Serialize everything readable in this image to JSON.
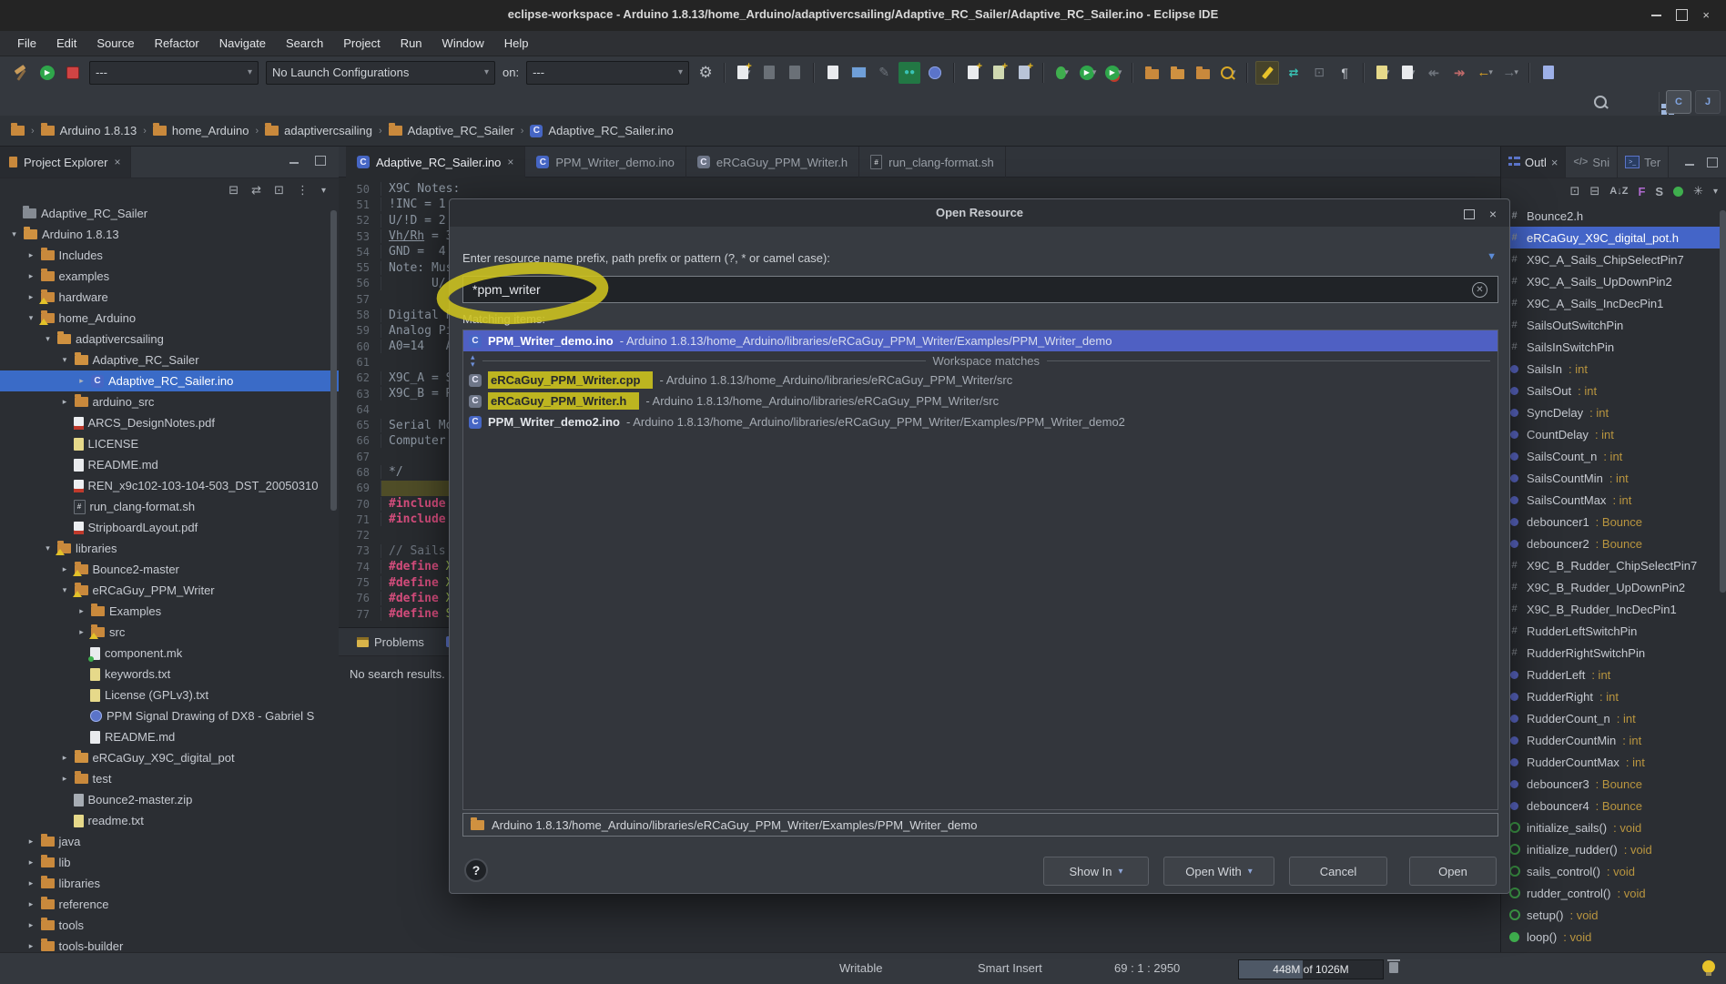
{
  "window": {
    "title": "eclipse-workspace - Arduino 1.8.13/home_Arduino/adaptivercsailing/Adaptive_RC_Sailer/Adaptive_RC_Sailer.ino - Eclipse IDE"
  },
  "menus": [
    "File",
    "Edit",
    "Source",
    "Refactor",
    "Navigate",
    "Search",
    "Project",
    "Run",
    "Window",
    "Help"
  ],
  "toolbar": {
    "combo1": "---",
    "combo2": "No Launch Configurations",
    "on_label": "on:",
    "combo3": "---"
  },
  "breadcrumb": {
    "items": [
      {
        "label": "Arduino 1.8.13",
        "icon": "folder"
      },
      {
        "label": "home_Arduino",
        "icon": "folder"
      },
      {
        "label": "adaptivercsailing",
        "icon": "folder"
      },
      {
        "label": "Adaptive_RC_Sailer",
        "icon": "folder"
      },
      {
        "label": "Adaptive_RC_Sailer.ino",
        "icon": "c"
      }
    ]
  },
  "project_explorer": {
    "title": "Project Explorer",
    "items": [
      {
        "label": "Adaptive_RC_Sailer",
        "level": 0,
        "arrow": "",
        "icon": "folder-gray"
      },
      {
        "label": "Arduino 1.8.13",
        "level": 0,
        "arrow": "v",
        "icon": "folder-open"
      },
      {
        "label": "Includes",
        "level": 1,
        "arrow": ">",
        "icon": "folder"
      },
      {
        "label": "examples",
        "level": 1,
        "arrow": ">",
        "icon": "folder"
      },
      {
        "label": "hardware",
        "level": 1,
        "arrow": ">",
        "icon": "folder-warn"
      },
      {
        "label": "home_Arduino",
        "level": 1,
        "arrow": "v",
        "icon": "folder-warn"
      },
      {
        "label": "adaptivercsailing",
        "level": 2,
        "arrow": "v",
        "icon": "folder-open"
      },
      {
        "label": "Adaptive_RC_Sailer",
        "level": 3,
        "arrow": "v",
        "icon": "folder-open"
      },
      {
        "label": "Adaptive_RC_Sailer.ino",
        "level": 4,
        "arrow": ">",
        "icon": "c-blue",
        "selected": true
      },
      {
        "label": "arduino_src",
        "level": 3,
        "arrow": ">",
        "icon": "folder"
      },
      {
        "label": "ARCS_DesignNotes.pdf",
        "level": 3,
        "arrow": "",
        "icon": "pdf"
      },
      {
        "label": "LICENSE",
        "level": 3,
        "arrow": "",
        "icon": "txt"
      },
      {
        "label": "README.md",
        "level": 3,
        "arrow": "",
        "icon": "md"
      },
      {
        "label": "REN_x9c102-103-104-503_DST_20050310",
        "level": 3,
        "arrow": "",
        "icon": "pdf"
      },
      {
        "label": "run_clang-format.sh",
        "level": 3,
        "arrow": "",
        "icon": "sh"
      },
      {
        "label": "StripboardLayout.pdf",
        "level": 3,
        "arrow": "",
        "icon": "pdf"
      },
      {
        "label": "libraries",
        "level": 2,
        "arrow": "v",
        "icon": "folder-warn"
      },
      {
        "label": "Bounce2-master",
        "level": 3,
        "arrow": ">",
        "icon": "folder-warn"
      },
      {
        "label": "eRCaGuy_PPM_Writer",
        "level": 3,
        "arrow": "v",
        "icon": "folder-warn"
      },
      {
        "label": "Examples",
        "level": 4,
        "arrow": ">",
        "icon": "folder"
      },
      {
        "label": "src",
        "level": 4,
        "arrow": ">",
        "icon": "folder-warn"
      },
      {
        "label": "component.mk",
        "level": 4,
        "arrow": "",
        "icon": "mk"
      },
      {
        "label": "keywords.txt",
        "level": 4,
        "arrow": "",
        "icon": "txt"
      },
      {
        "label": "License (GPLv3).txt",
        "level": 4,
        "arrow": "",
        "icon": "txt"
      },
      {
        "label": "PPM Signal Drawing of DX8 - Gabriel S",
        "level": 4,
        "arrow": "",
        "icon": "web"
      },
      {
        "label": "README.md",
        "level": 4,
        "arrow": "",
        "icon": "md"
      },
      {
        "label": "eRCaGuy_X9C_digital_pot",
        "level": 3,
        "arrow": ">",
        "icon": "folder-open"
      },
      {
        "label": "test",
        "level": 3,
        "arrow": ">",
        "icon": "folder"
      },
      {
        "label": "Bounce2-master.zip",
        "level": 3,
        "arrow": "",
        "icon": "zip"
      },
      {
        "label": "readme.txt",
        "level": 3,
        "arrow": "",
        "icon": "txt"
      },
      {
        "label": "java",
        "level": 1,
        "arrow": ">",
        "icon": "folder"
      },
      {
        "label": "lib",
        "level": 1,
        "arrow": ">",
        "icon": "folder"
      },
      {
        "label": "libraries",
        "level": 1,
        "arrow": ">",
        "icon": "folder"
      },
      {
        "label": "reference",
        "level": 1,
        "arrow": ">",
        "icon": "folder"
      },
      {
        "label": "tools",
        "level": 1,
        "arrow": ">",
        "icon": "folder"
      },
      {
        "label": "tools-builder",
        "level": 1,
        "arrow": ">",
        "icon": "folder"
      }
    ]
  },
  "editor": {
    "tabs": [
      {
        "label": "Adaptive_RC_Sailer.ino",
        "icon": "c-blue",
        "active": true,
        "closable": true
      },
      {
        "label": "PPM_Writer_demo.ino",
        "icon": "c-blue",
        "active": false
      },
      {
        "label": "eRCaGuy_PPM_Writer.h",
        "icon": "c-slate",
        "active": false
      },
      {
        "label": "run_clang-format.sh",
        "icon": "sh",
        "active": false
      }
    ],
    "lines": [
      {
        "n": "50",
        "segs": [
          [
            "X9C Notes:",
            "cmt"
          ]
        ]
      },
      {
        "n": "51",
        "segs": [
          [
            "!INC = 1",
            "cmt"
          ]
        ]
      },
      {
        "n": "52",
        "segs": [
          [
            "U/!D = 2",
            "cmt"
          ]
        ]
      },
      {
        "n": "53",
        "segs": [
          [
            "Vh/Rh",
            "cmt und"
          ],
          [
            " = 3",
            "cmt"
          ]
        ]
      },
      {
        "n": "54",
        "segs": [
          [
            "GND =  4",
            "cmt"
          ]
        ]
      },
      {
        "n": "55",
        "segs": [
          [
            "Note: Mus",
            "cmt"
          ]
        ]
      },
      {
        "n": "56",
        "segs": [
          [
            "      U/!D",
            "cmt"
          ]
        ]
      },
      {
        "n": "57",
        "segs": []
      },
      {
        "n": "58",
        "segs": [
          [
            "Digital P",
            "cmt"
          ]
        ]
      },
      {
        "n": "59",
        "segs": [
          [
            "Analog Pi",
            "cmt"
          ]
        ]
      },
      {
        "n": "60",
        "segs": [
          [
            "A0=14   A",
            "cmt"
          ]
        ]
      },
      {
        "n": "61",
        "segs": []
      },
      {
        "n": "62",
        "segs": [
          [
            "X9C_A = S",
            "cmt"
          ]
        ]
      },
      {
        "n": "63",
        "segs": [
          [
            "X9C_B = R",
            "cmt"
          ]
        ]
      },
      {
        "n": "64",
        "segs": []
      },
      {
        "n": "65",
        "segs": [
          [
            "Serial Mo",
            "cmt"
          ]
        ]
      },
      {
        "n": "66",
        "segs": [
          [
            "Computer",
            "cmt"
          ]
        ]
      },
      {
        "n": "67",
        "segs": []
      },
      {
        "n": "68",
        "segs": [
          [
            "*/",
            "cmt"
          ]
        ]
      },
      {
        "n": "69",
        "segs": [],
        "cur": true
      },
      {
        "n": "70",
        "segs": [
          [
            "#include",
            "dir"
          ]
        ]
      },
      {
        "n": "71",
        "segs": [
          [
            "#include",
            "dir"
          ]
        ]
      },
      {
        "n": "72",
        "segs": []
      },
      {
        "n": "73",
        "segs": [
          [
            "// Sails",
            "lc"
          ]
        ]
      },
      {
        "n": "74",
        "segs": [
          [
            "#define ",
            "dir"
          ],
          [
            "X",
            "grn"
          ]
        ]
      },
      {
        "n": "75",
        "segs": [
          [
            "#define ",
            "dir"
          ],
          [
            "X",
            "grn"
          ]
        ]
      },
      {
        "n": "76",
        "segs": [
          [
            "#define ",
            "dir"
          ],
          [
            "X",
            "grn"
          ]
        ]
      },
      {
        "n": "77",
        "segs": [
          [
            "#define ",
            "dir"
          ],
          [
            "S",
            "grn"
          ]
        ]
      }
    ]
  },
  "bottom_panel": {
    "tab1": "Problems",
    "message": "No search results."
  },
  "right_panel": {
    "tabs": [
      {
        "label": "Outl",
        "active": true
      },
      {
        "label": "Sni",
        "glyph": "</>"
      },
      {
        "label": "Ter"
      }
    ],
    "outline": [
      {
        "label": "Bounce2.h",
        "type": "inc"
      },
      {
        "label": "eRCaGuy_X9C_digital_pot.h",
        "type": "inc",
        "selected": true
      },
      {
        "label": "X9C_A_Sails_ChipSelectPin7",
        "type": "def"
      },
      {
        "label": "X9C_A_Sails_UpDownPin2",
        "type": "def"
      },
      {
        "label": "X9C_A_Sails_IncDecPin1",
        "type": "def"
      },
      {
        "label": "SailsOutSwitchPin",
        "type": "def"
      },
      {
        "label": "SailsInSwitchPin",
        "type": "def"
      },
      {
        "label": "SailsIn",
        "suffix": " : int",
        "type": "var"
      },
      {
        "label": "SailsOut",
        "suffix": " : int",
        "type": "var"
      },
      {
        "label": "SyncDelay",
        "suffix": " : int",
        "type": "var"
      },
      {
        "label": "CountDelay",
        "suffix": " : int",
        "type": "var"
      },
      {
        "label": "SailsCount_n",
        "suffix": " : int",
        "type": "var"
      },
      {
        "label": "SailsCountMin",
        "suffix": " : int",
        "type": "var"
      },
      {
        "label": "SailsCountMax",
        "suffix": " : int",
        "type": "var"
      },
      {
        "label": "debouncer1",
        "suffix": " : Bounce",
        "type": "var"
      },
      {
        "label": "debouncer2",
        "suffix": " : Bounce",
        "type": "var"
      },
      {
        "label": "X9C_B_Rudder_ChipSelectPin7",
        "type": "def"
      },
      {
        "label": "X9C_B_Rudder_UpDownPin2",
        "type": "def"
      },
      {
        "label": "X9C_B_Rudder_IncDecPin1",
        "type": "def"
      },
      {
        "label": "RudderLeftSwitchPin",
        "type": "def"
      },
      {
        "label": "RudderRightSwitchPin",
        "type": "def"
      },
      {
        "label": "RudderLeft",
        "suffix": " : int",
        "type": "var"
      },
      {
        "label": "RudderRight",
        "suffix": " : int",
        "type": "var"
      },
      {
        "label": "RudderCount_n",
        "suffix": " : int",
        "type": "var"
      },
      {
        "label": "RudderCountMin",
        "suffix": " : int",
        "type": "var"
      },
      {
        "label": "RudderCountMax",
        "suffix": " : int",
        "type": "var"
      },
      {
        "label": "debouncer3",
        "suffix": " : Bounce",
        "type": "var"
      },
      {
        "label": "debouncer4",
        "suffix": " : Bounce",
        "type": "var"
      },
      {
        "label": "initialize_sails()",
        "suffix": " : void",
        "type": "func"
      },
      {
        "label": "initialize_rudder()",
        "suffix": " : void",
        "type": "func"
      },
      {
        "label": "sails_control()",
        "suffix": " : void",
        "type": "func"
      },
      {
        "label": "rudder_control()",
        "suffix": " : void",
        "type": "func"
      },
      {
        "label": "setup()",
        "suffix": " : void",
        "type": "func"
      },
      {
        "label": "loop()",
        "suffix": " : void",
        "type": "func-pub"
      }
    ]
  },
  "dialog": {
    "title": "Open Resource",
    "prompt": "Enter resource name prefix, path prefix or pattern (?, * or camel case):",
    "query": "*ppm_writer",
    "matching_label": "Matching items:",
    "items": [
      {
        "name": "PPM_Writer_demo.ino",
        "path": " - Arduino 1.8.13/home_Arduino/libraries/eRCaGuy_PPM_Writer/Examples/PPM_Writer_demo",
        "icon": "ino",
        "selected": true
      },
      {
        "separator": "Workspace matches"
      },
      {
        "name": "eRCaGuy_PPM_Writer.cpp",
        "path": " - Arduino 1.8.13/home_Arduino/libraries/eRCaGuy_PPM_Writer/src",
        "icon": "cpp",
        "highlight": true
      },
      {
        "name": "eRCaGuy_PPM_Writer.h",
        "path": " - Arduino 1.8.13/home_Arduino/libraries/eRCaGuy_PPM_Writer/src",
        "icon": "h",
        "highlight": true
      },
      {
        "name": "PPM_Writer_demo2.ino",
        "path": " - Arduino 1.8.13/home_Arduino/libraries/eRCaGuy_PPM_Writer/Examples/PPM_Writer_demo2",
        "icon": "ino"
      }
    ],
    "selected_path": "Arduino 1.8.13/home_Arduino/libraries/eRCaGuy_PPM_Writer/Examples/PPM_Writer_demo",
    "help_label": "?",
    "buttons": {
      "show_in": "Show In",
      "open_with": "Open With",
      "cancel": "Cancel",
      "open": "Open"
    }
  },
  "status_bar": {
    "writable": "Writable",
    "insert_mode": "Smart Insert",
    "caret_position": "69 : 1 : 2950",
    "heap_label": "448M of 1026M",
    "heap_fill_percent": 44
  },
  "colors": {
    "tree_selection": "#3a6bc7",
    "dialog_selection": "#4f60c3",
    "annotation_yellow": "#cfc41f",
    "directive_pink": "#d64d7d",
    "folder_orange": "#c9893c"
  }
}
